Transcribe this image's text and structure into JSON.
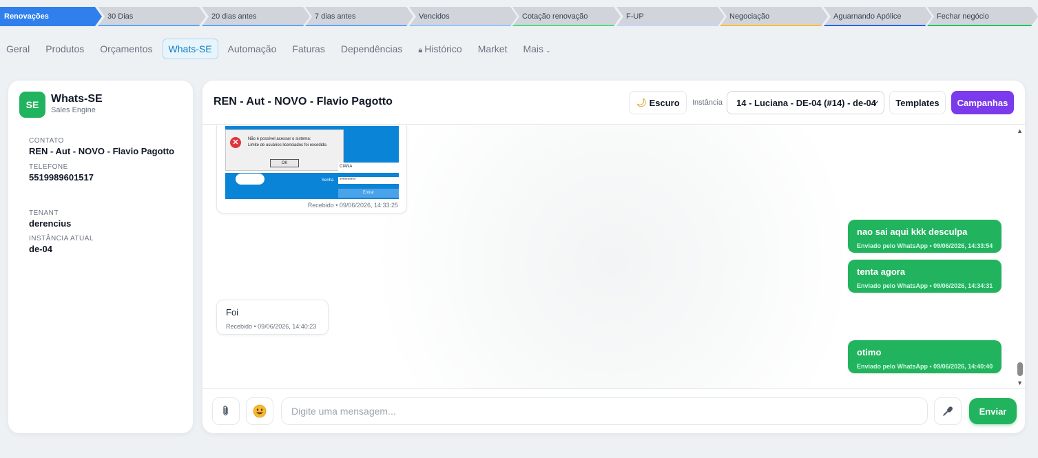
{
  "pipeline": {
    "stages": [
      {
        "label": "Renovações",
        "color": "#2f80ed",
        "active": true
      },
      {
        "label": "30 Dias",
        "color": "#60a5fa"
      },
      {
        "label": "20 dias antes",
        "color": "#60a5fa"
      },
      {
        "label": "7 dias antes",
        "color": "#60a5fa"
      },
      {
        "label": "Vencidos",
        "color": "#93c5fd"
      },
      {
        "label": "Cotação renovação",
        "color": "#4ade80"
      },
      {
        "label": "F-UP",
        "color": "#c7d2fe"
      },
      {
        "label": "Negociação",
        "color": "#fbbf24"
      },
      {
        "label": "Aguarnando Apólice",
        "color": "#2563eb"
      },
      {
        "label": "Fechar negócio",
        "color": "#22c55e"
      }
    ]
  },
  "tabs": [
    {
      "label": "Geral"
    },
    {
      "label": "Produtos"
    },
    {
      "label": "Orçamentos"
    },
    {
      "label": "Whats-SE",
      "active": true
    },
    {
      "label": "Automação"
    },
    {
      "label": "Faturas"
    },
    {
      "label": "Dependências"
    },
    {
      "label": "Histórico",
      "icon": "lock-icon"
    },
    {
      "label": "Market"
    },
    {
      "label": "Mais",
      "icon": "chevron-down-icon"
    }
  ],
  "sidebar": {
    "avatar": "SE",
    "app_name": "Whats-SE",
    "app_subtitle": "Sales Engine",
    "contato_label": "CONTATO",
    "contato_value": "REN - Aut - NOVO - Flavio Pagotto",
    "telefone_label": "TELEFONE",
    "telefone_value": "5519989601517",
    "tenant_label": "TENANT",
    "tenant_value": "derencius",
    "instancia_label": "INSTÂNCIA ATUAL",
    "instancia_value": "de-04"
  },
  "chat": {
    "title": "REN - Aut - NOVO - Flavio Pagotto",
    "theme_button": "Escuro",
    "theme_icon": "moon-icon",
    "instance_label": "Instância",
    "instance_selected": "14 - Luciana - DE-04 (#14) - de-04",
    "templates_button": "Templates",
    "campaigns_button": "Campanhas",
    "campaigns_color": "#7c3aed",
    "image_message": {
      "dialog_line1": "Não é possível acessar o sistema:",
      "dialog_line2": "Limite de usuários licenciados foi excedido.",
      "ok": "OK",
      "user_field": "CIANA",
      "senha_label": "Senha",
      "password": "**********",
      "entrar": "Entrar",
      "meta": "Recebido • 09/06/2026, 14:33:25"
    },
    "messages": [
      {
        "direction": "out",
        "text": "nao sai aqui kkk desculpa",
        "meta": "Enviado pelo WhatsApp • 09/06/2026, 14:33:54"
      },
      {
        "direction": "out",
        "text": "tenta agora",
        "meta": "Enviado pelo WhatsApp • 09/06/2026, 14:34:31"
      },
      {
        "direction": "in",
        "text": "Foi",
        "meta": "Recebido • 09/06/2026, 14:40:23"
      },
      {
        "direction": "out",
        "text": "otimo",
        "meta": "Enviado pelo WhatsApp • 09/06/2026, 14:40:40"
      }
    ],
    "composer": {
      "placeholder": "Digite uma mensagem...",
      "send_button": "Enviar",
      "attach_icon": "paperclip-icon",
      "emoji_icon": "smiley-icon",
      "mic_icon": "microphone-icon"
    }
  }
}
